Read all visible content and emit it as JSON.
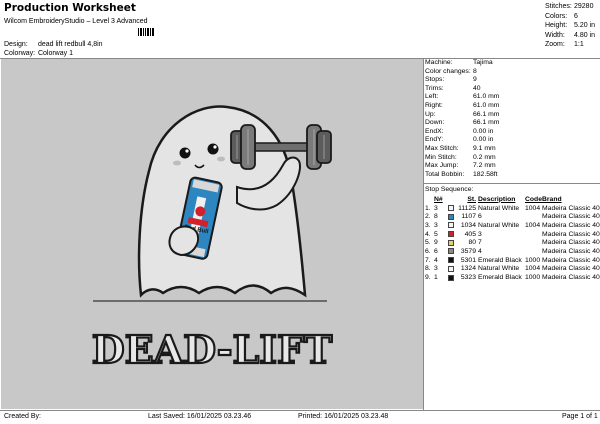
{
  "header": {
    "title": "Production Worksheet",
    "subtitle": "Wilcom EmbroideryStudio – Level 3 Advanced",
    "design_label": "Design:",
    "design_value": "dead lift redbull 4,8in",
    "colorway_label": "Colorway:",
    "colorway_value": "Colorway 1"
  },
  "stats": [
    {
      "label": "Stitches:",
      "value": "29280"
    },
    {
      "label": "Colors:",
      "value": "6"
    },
    {
      "label": "Height:",
      "value": "5.20 in"
    },
    {
      "label": "Width:",
      "value": "4.80 in"
    },
    {
      "label": "Zoom:",
      "value": "1:1"
    }
  ],
  "info": [
    {
      "label": "Machine:",
      "value": "Tajima"
    },
    {
      "label": "Color changes:",
      "value": "8"
    },
    {
      "label": "Stops:",
      "value": "9"
    },
    {
      "label": "Trims:",
      "value": "40"
    },
    {
      "label": "Left:",
      "value": "61.0 mm"
    },
    {
      "label": "Right:",
      "value": "61.0 mm"
    },
    {
      "label": "Up:",
      "value": "66.1 mm"
    },
    {
      "label": "Down:",
      "value": "66.1 mm"
    },
    {
      "label": "EndX:",
      "value": "0.00 in"
    },
    {
      "label": "EndY:",
      "value": "0.00 in"
    },
    {
      "label": "Max Stitch:",
      "value": "9.1 mm"
    },
    {
      "label": "Min Stitch:",
      "value": "0.2 mm"
    },
    {
      "label": "Max Jump:",
      "value": "7.2 mm"
    },
    {
      "label": "Total Bobbin:",
      "value": "182.58ft"
    }
  ],
  "sequence": {
    "title": "Stop Sequence:",
    "headers": {
      "n": "N#",
      "st": "St.",
      "desc": "Description",
      "code": "Code",
      "brand": "Brand"
    },
    "rows": [
      {
        "idx": "1.",
        "n": "3",
        "color": "#f4f4f4",
        "st": "11125",
        "desc": "Natural White",
        "code": "1004",
        "brand": "Madeira Classic 40"
      },
      {
        "idx": "2.",
        "n": "8",
        "color": "#2e86c1",
        "st": "1107",
        "desc": "6",
        "code": "",
        "brand": "Madeira Classic 40"
      },
      {
        "idx": "3.",
        "n": "3",
        "color": "#f4f4f4",
        "st": "1034",
        "desc": "Natural White",
        "code": "1004",
        "brand": "Madeira Classic 40"
      },
      {
        "idx": "4.",
        "n": "5",
        "color": "#d4202a",
        "st": "405",
        "desc": "3",
        "code": "",
        "brand": "Madeira Classic 40"
      },
      {
        "idx": "5.",
        "n": "9",
        "color": "#e8d068",
        "st": "80",
        "desc": "7",
        "code": "",
        "brand": "Madeira Classic 40"
      },
      {
        "idx": "6.",
        "n": "6",
        "color": "#8a8a8a",
        "st": "3579",
        "desc": "4",
        "code": "",
        "brand": "Madeira Classic 40"
      },
      {
        "idx": "7.",
        "n": "4",
        "color": "#111111",
        "st": "5301",
        "desc": "Emerald Black",
        "code": "1000",
        "brand": "Madeira Classic 40"
      },
      {
        "idx": "8.",
        "n": "3",
        "color": "#f4f4f4",
        "st": "1324",
        "desc": "Natural White",
        "code": "1004",
        "brand": "Madeira Classic 40"
      },
      {
        "idx": "9.",
        "n": "1",
        "color": "#111111",
        "st": "5323",
        "desc": "Emerald Black",
        "code": "1000",
        "brand": "Madeira Classic 40"
      }
    ]
  },
  "design_text": "DEAD-LIFT",
  "can_text": "Red Bull",
  "footer": {
    "created_by": "Created By:",
    "last_saved": "Last Saved: 16/01/2025 03.23.46",
    "printed": "Printed: 16/01/2025 03.23.48",
    "page": "Page 1 of 1"
  },
  "colors": {
    "canvas": "#c8c8c8",
    "ghost": "#e4e4e4",
    "outline": "#1a1a1a",
    "can_blue": "#2e86c1",
    "can_red": "#d4202a"
  }
}
